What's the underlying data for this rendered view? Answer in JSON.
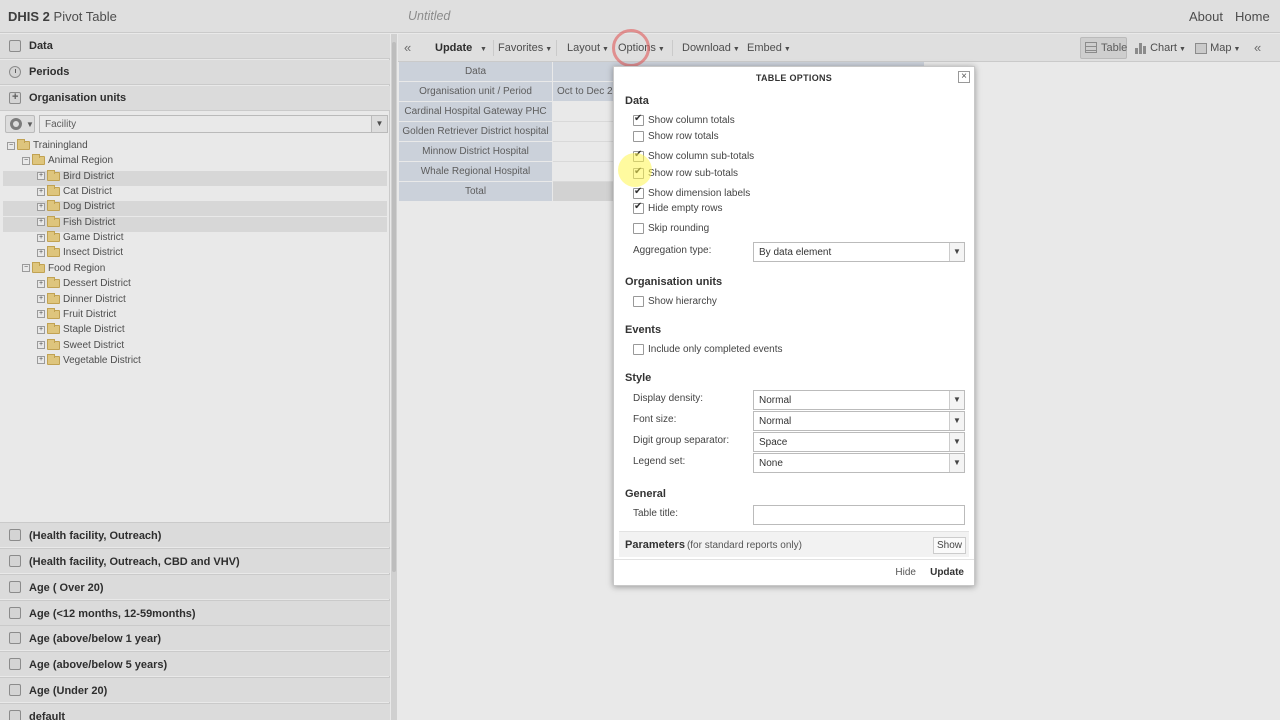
{
  "app": {
    "title_bold": "DHIS 2",
    "title_rest": " Pivot Table",
    "untitled": "Untitled"
  },
  "top_links": {
    "about": "About",
    "home": "Home"
  },
  "left_panel": {
    "sections": [
      {
        "label": "Data",
        "icon": "data-icon"
      },
      {
        "label": "Periods",
        "icon": "clock-icon"
      },
      {
        "label": "Organisation units",
        "icon": "plus-icon"
      }
    ],
    "level_select": "Facility",
    "tree": [
      {
        "label": "Trainingland",
        "level": 0,
        "exp": "−"
      },
      {
        "label": "Animal Region",
        "level": 1,
        "exp": "−"
      },
      {
        "label": "Bird District",
        "level": 2,
        "exp": "+",
        "highlight": true
      },
      {
        "label": "Cat District",
        "level": 2,
        "exp": "+"
      },
      {
        "label": "Dog District",
        "level": 2,
        "exp": "+",
        "highlight": true
      },
      {
        "label": "Fish District",
        "level": 2,
        "exp": "+",
        "highlight": true
      },
      {
        "label": "Game District",
        "level": 2,
        "exp": "+"
      },
      {
        "label": "Insect District",
        "level": 2,
        "exp": "+"
      },
      {
        "label": "Food Region",
        "level": 1,
        "exp": "−"
      },
      {
        "label": "Dessert District",
        "level": 2,
        "exp": "+"
      },
      {
        "label": "Dinner District",
        "level": 2,
        "exp": "+"
      },
      {
        "label": "Fruit District",
        "level": 2,
        "exp": "+"
      },
      {
        "label": "Staple District",
        "level": 2,
        "exp": "+"
      },
      {
        "label": "Sweet District",
        "level": 2,
        "exp": "+"
      },
      {
        "label": "Vegetable District",
        "level": 2,
        "exp": "+"
      }
    ],
    "dimension_groups": [
      "(Health facility, Outreach)",
      "(Health facility, Outreach, CBD and VHV)",
      "Age ( Over 20)",
      "Age (<12 months, 12-59months)",
      "Age (above/below 1 year)",
      "Age (above/below 5 years)",
      "Age (Under 20)",
      "default"
    ]
  },
  "toolbar": {
    "update": "Update",
    "favorites": "Favorites",
    "layout": "Layout",
    "options": "Options",
    "download": "Download",
    "embed": "Embed",
    "table": "Table",
    "chart": "Chart",
    "map": "Map"
  },
  "pivot": {
    "header_dim": "Data",
    "row_header": "Organisation unit / Period",
    "period": "Oct to Dec 2",
    "rows": [
      "Cardinal Hospital Gateway PHC",
      "Golden Retriever District hospital",
      "Minnow District Hospital",
      "Whale Regional Hospital"
    ],
    "total": "Total"
  },
  "dialog": {
    "title": "TABLE OPTIONS",
    "data_title": "Data",
    "options": {
      "show_column_totals": {
        "label": "Show column totals",
        "checked": true
      },
      "show_row_totals": {
        "label": "Show row totals",
        "checked": false
      },
      "show_column_sub_totals": {
        "label": "Show column sub-totals",
        "checked": true
      },
      "show_row_sub_totals": {
        "label": "Show row sub-totals",
        "checked": true
      },
      "show_dimension_labels": {
        "label": "Show dimension labels",
        "checked": true
      },
      "hide_empty_rows": {
        "label": "Hide empty rows",
        "checked": true
      },
      "skip_rounding": {
        "label": "Skip rounding",
        "checked": false
      }
    },
    "aggregation_label": "Aggregation type:",
    "aggregation_value": "By data element",
    "org_title": "Organisation units",
    "show_hierarchy": {
      "label": "Show hierarchy",
      "checked": false
    },
    "events_title": "Events",
    "include_completed": {
      "label": "Include only completed events",
      "checked": false
    },
    "style_title": "Style",
    "display_density_label": "Display density:",
    "display_density_value": "Normal",
    "font_size_label": "Font size:",
    "font_size_value": "Normal",
    "digit_sep_label": "Digit group separator:",
    "digit_sep_value": "Space",
    "legend_set_label": "Legend set:",
    "legend_set_value": "None",
    "general_title": "General",
    "table_title_label": "Table title:",
    "table_title_value": "",
    "parameters_label": "Parameters",
    "parameters_sub": "(for standard reports only)",
    "show_button": "Show",
    "hide_button": "Hide",
    "update_button": "Update"
  },
  "colors": {
    "dimension_bg": "#dfe5ef",
    "total_bg": "#e6e6e6",
    "folder": "#f3d889",
    "ring": "#e15a5a",
    "cursor_highlight": "#fff550"
  }
}
